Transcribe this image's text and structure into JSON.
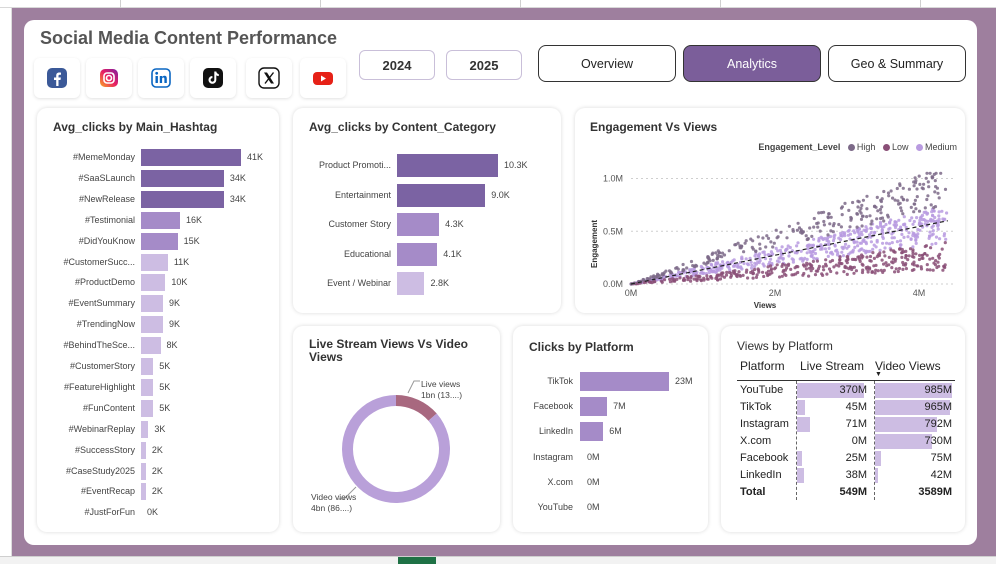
{
  "header": {
    "title": "Social Media Content Performance",
    "years": [
      "2024",
      "2025"
    ],
    "nav": [
      {
        "label": "Overview",
        "active": false
      },
      {
        "label": "Analytics",
        "active": true
      },
      {
        "label": "Geo & Summary",
        "active": false
      }
    ],
    "platform_icons": [
      "facebook-icon",
      "instagram-icon",
      "linkedin-icon",
      "tiktok-icon",
      "x-icon",
      "youtube-icon"
    ]
  },
  "colors": {
    "accent": "#7b5e9a",
    "bar_dark": "#7b63a3",
    "bar_mid": "#a58bc8",
    "bar_light": "#cdbde3",
    "high": "#7c6a88",
    "low": "#8a4f77",
    "medium": "#b99be0",
    "live": "#a8687f",
    "video": "#b9a0d9"
  },
  "hashtag_chart": {
    "title": "Avg_clicks by Main_Hashtag",
    "chart_data": {
      "type": "bar",
      "categories": [
        "#MemeMonday",
        "#SaaSLaunch",
        "#NewRelease",
        "#Testimonial",
        "#DidYouKnow",
        "#CustomerSucc...",
        "#ProductDemo",
        "#EventSummary",
        "#TrendingNow",
        "#BehindTheSce...",
        "#CustomerStory",
        "#FeatureHighlight",
        "#FunContent",
        "#WebinarReplay",
        "#SuccessStory",
        "#CaseStudy2025",
        "#EventRecap",
        "#JustForFun"
      ],
      "values": [
        41000,
        34000,
        34000,
        16000,
        15000,
        11000,
        10000,
        9000,
        9000,
        8000,
        5000,
        5000,
        5000,
        3000,
        2000,
        2000,
        2000,
        0
      ],
      "labels": [
        "41K",
        "34K",
        "34K",
        "16K",
        "15K",
        "11K",
        "10K",
        "9K",
        "9K",
        "8K",
        "5K",
        "5K",
        "5K",
        "3K",
        "2K",
        "2K",
        "2K",
        "0K"
      ]
    }
  },
  "category_chart": {
    "title": "Avg_clicks by Content_Category",
    "chart_data": {
      "type": "bar",
      "categories": [
        "Product Promoti...",
        "Entertainment",
        "Customer Story",
        "Educational",
        "Event / Webinar"
      ],
      "values": [
        10300,
        9000,
        4300,
        4100,
        2800
      ],
      "labels": [
        "10.3K",
        "9.0K",
        "4.3K",
        "4.1K",
        "2.8K"
      ]
    }
  },
  "scatter_chart": {
    "title": "Engagement Vs Views",
    "chart_data": {
      "type": "scatter",
      "xlabel": "Views",
      "ylabel": "Engagement",
      "x_ticks": [
        "0M",
        "2M",
        "4M"
      ],
      "y_ticks": [
        "0.0M",
        "0.5M",
        "1.0M"
      ],
      "xlim": [
        0,
        4.5
      ],
      "ylim": [
        0,
        1.1
      ],
      "legend_title": "Engagement_Level",
      "legend": [
        "High",
        "Low",
        "Medium"
      ],
      "legend_position": "top-right",
      "trend_line": true
    }
  },
  "donut_chart": {
    "title": "Live Stream Views Vs Video Views",
    "chart_data": {
      "type": "pie",
      "categories": [
        "Live views",
        "Video views"
      ],
      "values": [
        1,
        4
      ],
      "labels": [
        "Live views\n1bn (13....)",
        "Video views\n4bn (86....)"
      ]
    },
    "live_label_1": "Live views",
    "live_label_2": "1bn (13....)",
    "video_label_1": "Video views",
    "video_label_2": "4bn (86....)"
  },
  "platform_clicks": {
    "title": "Clicks by Platform",
    "chart_data": {
      "type": "bar",
      "categories": [
        "TikTok",
        "Facebook",
        "LinkedIn",
        "Instagram",
        "X.com",
        "YouTube"
      ],
      "values": [
        23,
        7,
        6,
        0,
        0,
        0
      ],
      "labels": [
        "23M",
        "7M",
        "6M",
        "0M",
        "0M",
        "0M"
      ]
    }
  },
  "views_table": {
    "title": "Views by Platform",
    "columns": [
      "Platform",
      "Live Stream",
      "Video Views"
    ],
    "rows": [
      {
        "platform": "YouTube",
        "live": "370M",
        "video": "985M",
        "live_v": 370,
        "video_v": 985
      },
      {
        "platform": "TikTok",
        "live": "45M",
        "video": "965M",
        "live_v": 45,
        "video_v": 965
      },
      {
        "platform": "Instagram",
        "live": "71M",
        "video": "792M",
        "live_v": 71,
        "video_v": 792
      },
      {
        "platform": "X.com",
        "live": "0M",
        "video": "730M",
        "live_v": 0,
        "video_v": 730
      },
      {
        "platform": "Facebook",
        "live": "25M",
        "video": "75M",
        "live_v": 25,
        "video_v": 75
      },
      {
        "platform": "LinkedIn",
        "live": "38M",
        "video": "42M",
        "live_v": 38,
        "video_v": 42
      }
    ],
    "total": {
      "platform": "Total",
      "live": "549M",
      "video": "3589M"
    }
  }
}
